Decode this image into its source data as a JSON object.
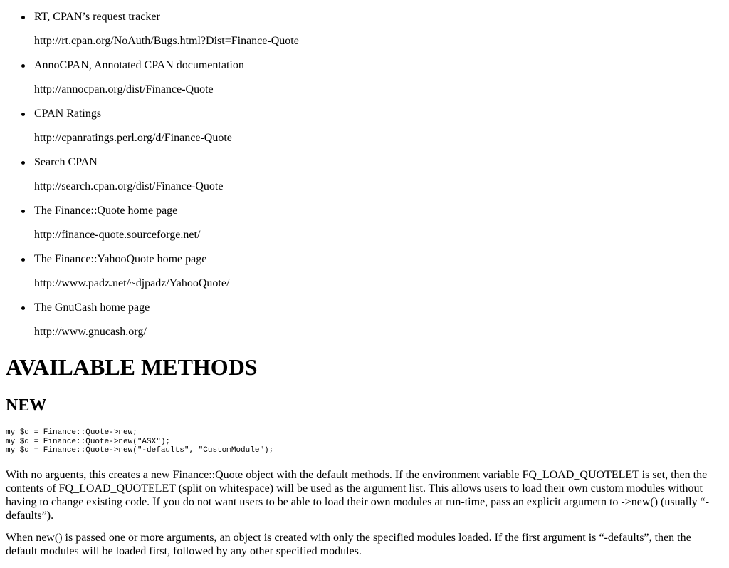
{
  "links": [
    {
      "title": "RT, CPAN’s request tracker",
      "url": "http://rt.cpan.org/NoAuth/Bugs.html?Dist=Finance-Quote"
    },
    {
      "title": "AnnoCPAN, Annotated CPAN documentation",
      "url": "http://annocpan.org/dist/Finance-Quote"
    },
    {
      "title": "CPAN Ratings",
      "url": "http://cpanratings.perl.org/d/Finance-Quote"
    },
    {
      "title": "Search CPAN",
      "url": "http://search.cpan.org/dist/Finance-Quote"
    },
    {
      "title": "The Finance::Quote home page",
      "url": "http://finance-quote.sourceforge.net/"
    },
    {
      "title": "The Finance::YahooQuote home page",
      "url": "http://www.padz.net/~djpadz/YahooQuote/"
    },
    {
      "title": "The GnuCash home page",
      "url": "http://www.gnucash.org/"
    }
  ],
  "section_heading": "AVAILABLE METHODS",
  "subsection_heading": "NEW",
  "code_lines": [
    "my $q = Finance::Quote->new;",
    "my $q = Finance::Quote->new(\"ASX\");",
    "my $q = Finance::Quote->new(\"-defaults\", \"CustomModule\");"
  ],
  "paragraphs": [
    "With no arguents, this creates a new Finance::Quote object with the default methods. If the environment variable FQ_LOAD_QUOTELET is set, then the contents of FQ_LOAD_QUOTELET (split on whitespace) will be used as the argument list. This allows users to load their own custom modules without having to change existing code. If you do not want users to be able to load their own modules at run-time, pass an explicit argumetn to ->new() (usually “-defaults”).",
    "When new() is passed one or more arguments, an object is created with only the specified modules loaded. If the first argument is “-defaults”, then the default modules will be loaded first, followed by any other specified modules."
  ]
}
